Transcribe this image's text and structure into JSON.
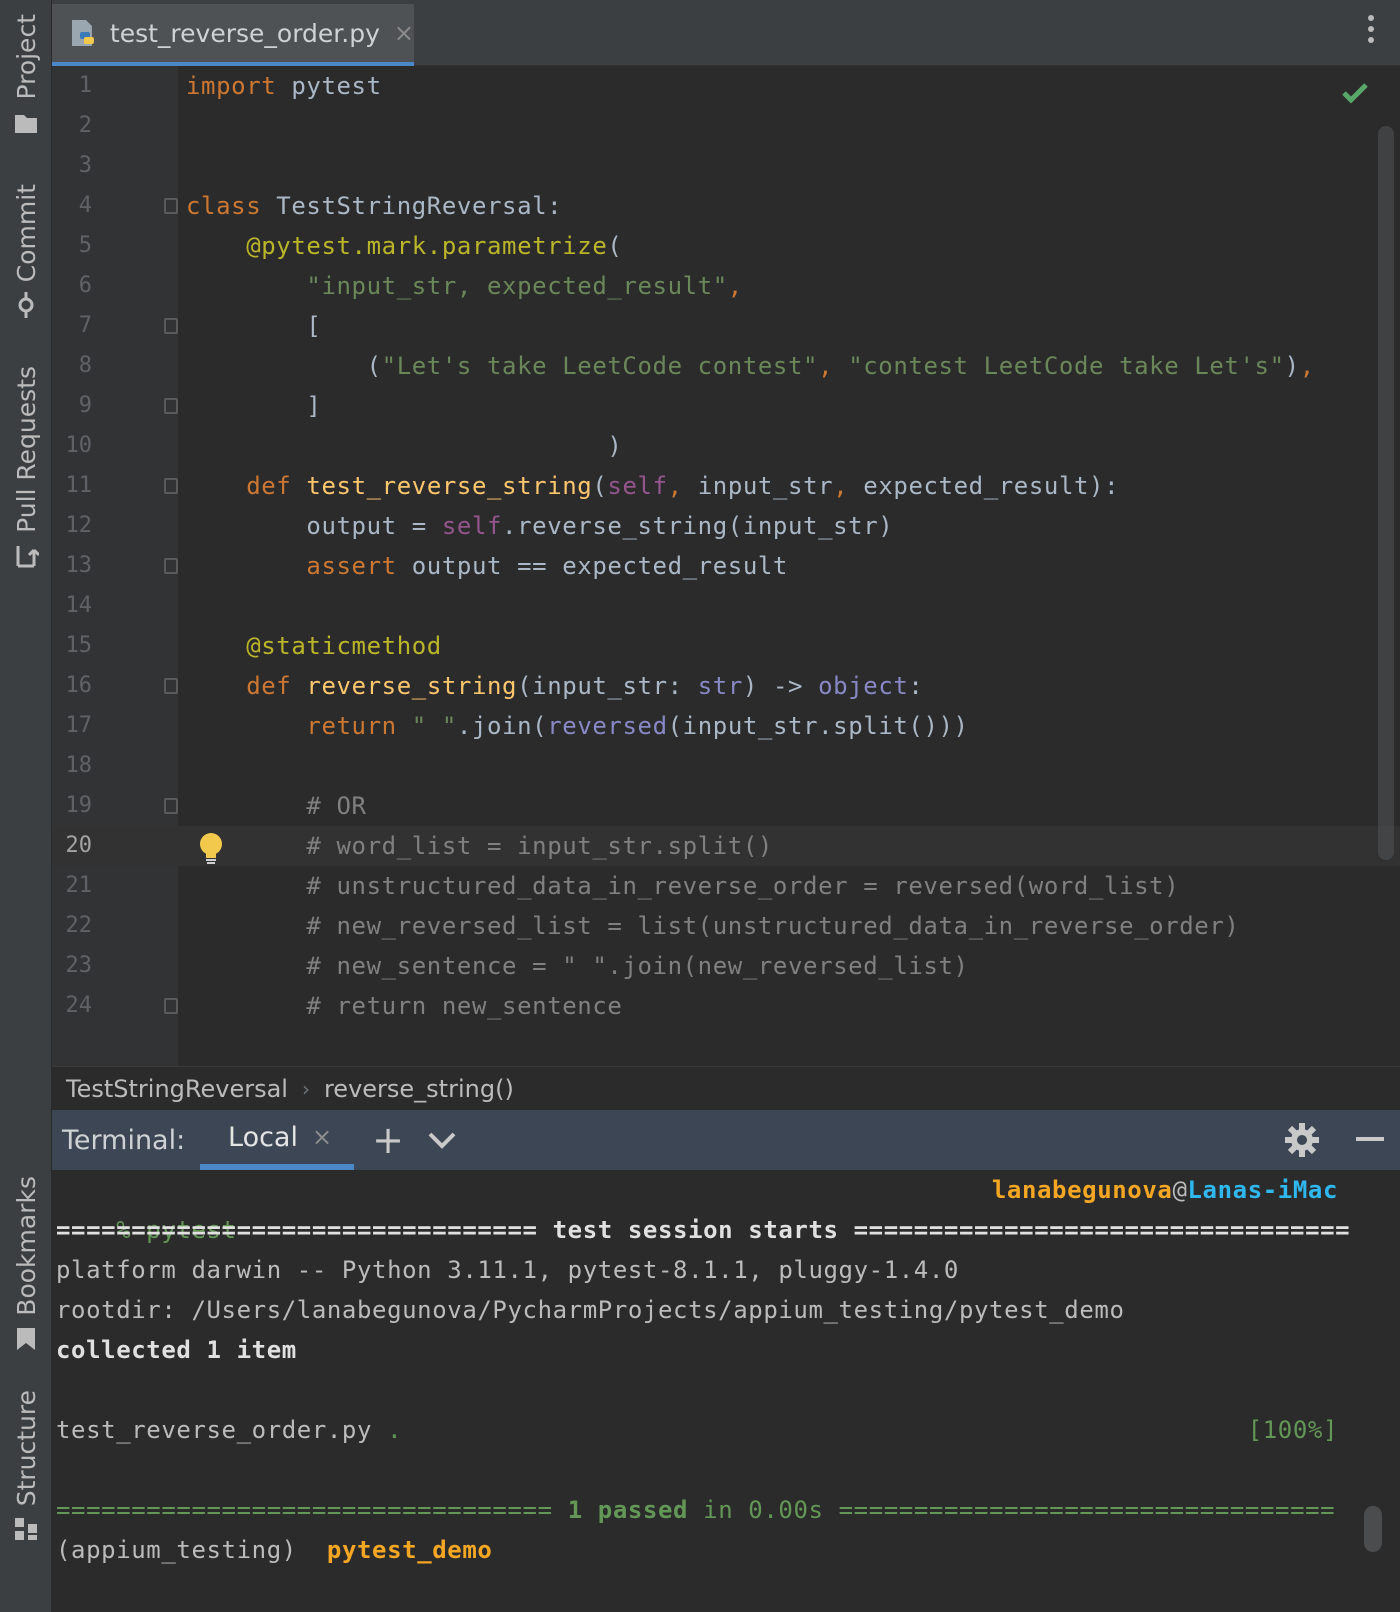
{
  "left_tools": [
    {
      "label": "Project",
      "icon": "folder-icon"
    },
    {
      "label": "Commit",
      "icon": "commit-icon"
    },
    {
      "label": "Pull Requests",
      "icon": "pull-request-icon"
    },
    {
      "label": "Bookmarks",
      "icon": "bookmark-icon"
    },
    {
      "label": "Structure",
      "icon": "structure-icon"
    }
  ],
  "editor_tab": {
    "label": "test_reverse_order.py",
    "close": "×",
    "icon": "python-file-icon"
  },
  "editor": {
    "current_line": 20,
    "line_numbers": [
      "1",
      "2",
      "3",
      "4",
      "5",
      "6",
      "7",
      "8",
      "9",
      "10",
      "11",
      "12",
      "13",
      "14",
      "15",
      "16",
      "17",
      "18",
      "19",
      "20",
      "21",
      "22",
      "23",
      "24"
    ],
    "status_icon": "check-icon",
    "intention_icon": "lightbulb-icon"
  },
  "breadcrumb": {
    "items": [
      "TestStringReversal",
      "reverse_string()"
    ],
    "separator": "›"
  },
  "terminal": {
    "title": "Terminal:",
    "tab_label": "Local",
    "tab_close": "×",
    "add_label": "+",
    "prompt": "% pytest",
    "user": "lanabegunova",
    "at": "@",
    "host": "Lanas-iMac",
    "session_start": "================================ test session starts =================================",
    "platform": "platform darwin -- Python 3.11.1, pytest-8.1.1, pluggy-1.4.0",
    "rootdir": "rootdir: /Users/lanabegunova/PycharmProjects/appium_testing/pytest_demo",
    "collected": "collected 1 item",
    "test_file": "test_reverse_order.py",
    "test_dot": ".",
    "test_percent": "[100%]",
    "summary_left": "================================= ",
    "summary_passed": "1 passed",
    "summary_mid": " in 0.00s ",
    "summary_right": "=================================",
    "env": "(appium_testing)",
    "cwd": "pytest_demo"
  },
  "colors": {
    "keyword": "#cc7832",
    "string": "#6a8759",
    "decorator": "#bbb529",
    "function": "#ffc66d",
    "self": "#94558d",
    "comment": "#808080",
    "accent": "#4a88c7",
    "terminal_green": "#629755",
    "terminal_orange": "#f5a623",
    "terminal_blue": "#2fb7f0"
  }
}
